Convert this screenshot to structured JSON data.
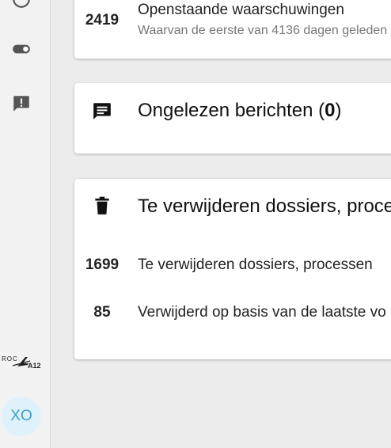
{
  "warnings": {
    "count": "2419",
    "title": "Openstaande waarschuwingen",
    "subtitle": "Waarvan de eerste van 4136 dagen geleden"
  },
  "messages": {
    "title_prefix": "Ongelezen berichten (",
    "count": "0",
    "title_suffix": ")"
  },
  "deletions": {
    "title": "Te verwijderen dossiers, processen",
    "rows": [
      {
        "count": "1699",
        "label": "Te verwijderen dossiers, processen"
      },
      {
        "count": "85",
        "label": "Verwijderd op basis van de laatste vo"
      }
    ]
  },
  "logo": {
    "text": "ROC A12"
  },
  "user": {
    "initials": "XO"
  },
  "colors": {
    "accent": "#3aa0cf",
    "avatar_bg": "#dff1fb"
  }
}
